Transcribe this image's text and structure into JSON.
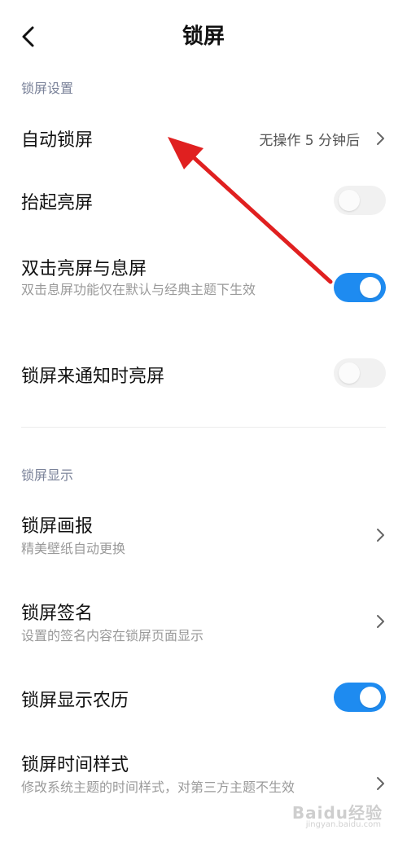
{
  "header": {
    "title": "锁屏"
  },
  "sections": {
    "lock_settings": "锁屏设置",
    "lock_display": "锁屏显示"
  },
  "rows": {
    "auto_lock": {
      "title": "自动锁屏",
      "value": "无操作 5 分钟后"
    },
    "lift_wake": {
      "title": "抬起亮屏",
      "enabled": false
    },
    "double_tap": {
      "title": "双击亮屏与息屏",
      "subtitle": "双击息屏功能仅在默认与经典主题下生效",
      "enabled": true
    },
    "notify_wake": {
      "title": "锁屏来通知时亮屏",
      "enabled": false
    },
    "wallpaper": {
      "title": "锁屏画报",
      "subtitle": "精美壁纸自动更换"
    },
    "signature": {
      "title": "锁屏签名",
      "subtitle": "设置的签名内容在锁屏页面显示"
    },
    "lunar": {
      "title": "锁屏显示农历",
      "enabled": true
    },
    "time_style": {
      "title": "锁屏时间样式",
      "subtitle": "修改系统主题的时间样式，对第三方主题不生效"
    }
  },
  "watermark": {
    "brand": "Baidu经验",
    "url": "jingyan.baidu.com"
  },
  "colors": {
    "toggle_on": "#1e8bf0",
    "toggle_off": "#f1f1f1",
    "annotation_arrow": "#e02020"
  },
  "icons": {
    "back": "back-arrow-icon",
    "chevron": "chevron-right-icon"
  }
}
